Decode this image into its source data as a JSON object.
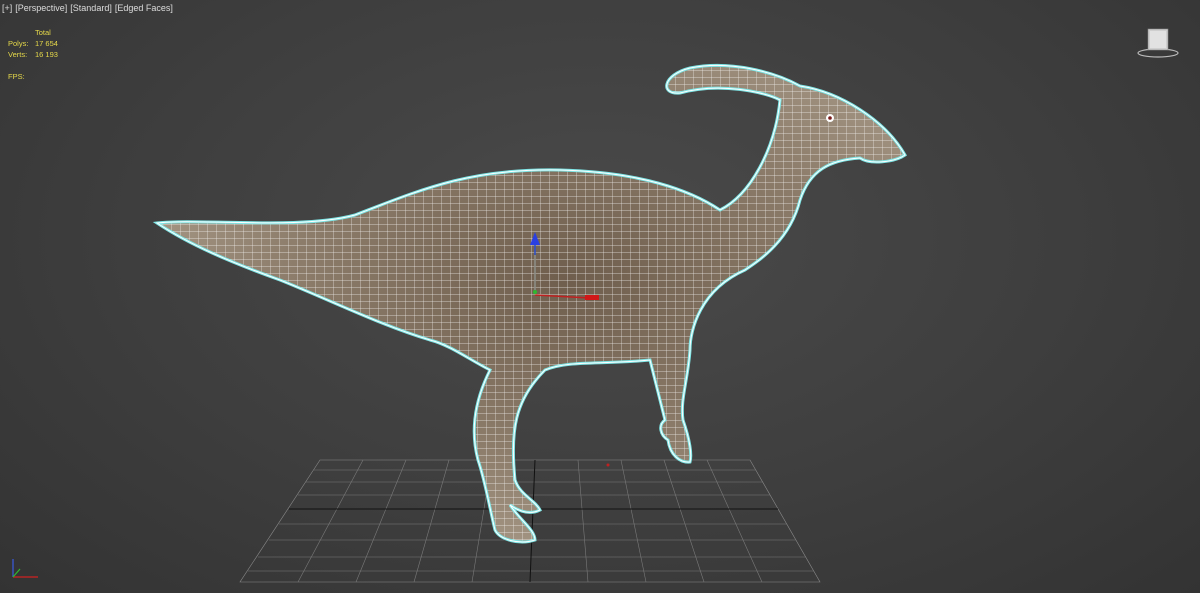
{
  "viewport": {
    "label": {
      "menu": "[+]",
      "view": "[Perspective]",
      "shading": "[Standard]",
      "display": "[Edged Faces]"
    },
    "stats": {
      "header": "Total",
      "polys_label": "Polys:",
      "polys_value": "17 654",
      "verts_label": "Verts:",
      "verts_value": "16 193",
      "fps_label": "FPS:"
    },
    "viewcube": {
      "face": "left-view"
    },
    "model": {
      "name_icon": "parasaurolophus-mesh",
      "selection_color": "#7fe6e6",
      "wire_color": "#ffffff",
      "skin_color": "#8a7a67"
    }
  }
}
